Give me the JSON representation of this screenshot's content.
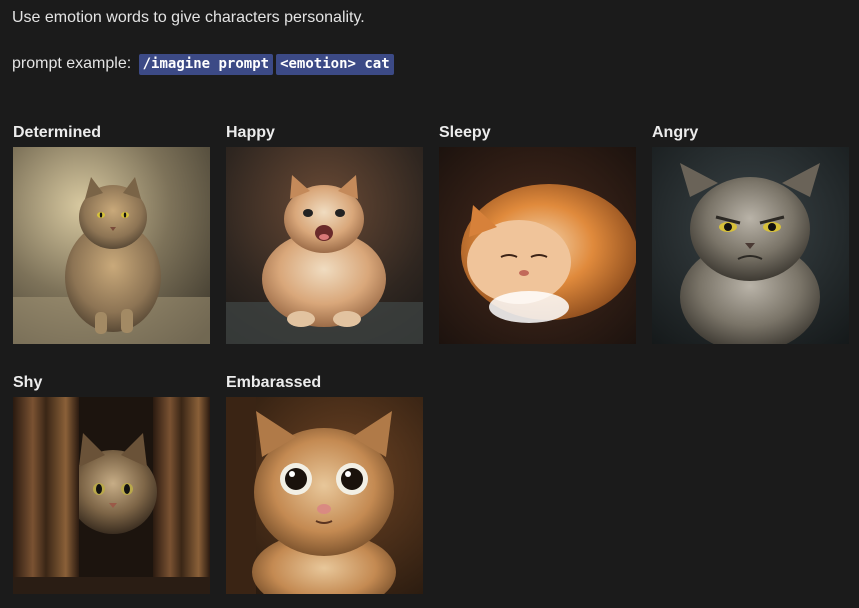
{
  "intro_text": "Use emotion words to give characters personality.",
  "prompt_example": {
    "label": "prompt example:",
    "code_1": "/imagine prompt",
    "code_2": "<emotion> cat"
  },
  "gallery": [
    {
      "label": "Determined",
      "image": "fluffy-tabby-cat-walking-photo"
    },
    {
      "label": "Happy",
      "image": "fluffy-orange-cat-smiling-photo"
    },
    {
      "label": "Sleepy",
      "image": "orange-cat-curled-sleeping-photo"
    },
    {
      "label": "Angry",
      "image": "grey-persian-cat-frowning-photo"
    },
    {
      "label": "Shy",
      "image": "tabby-cat-peeking-behind-curtain-photo"
    },
    {
      "label": "Embarassed",
      "image": "wide-eyed-orange-kitten-photo"
    }
  ],
  "colors": {
    "background": "#1b1b1b",
    "code_background": "#3c4a86",
    "text": "#e6e6e6"
  }
}
